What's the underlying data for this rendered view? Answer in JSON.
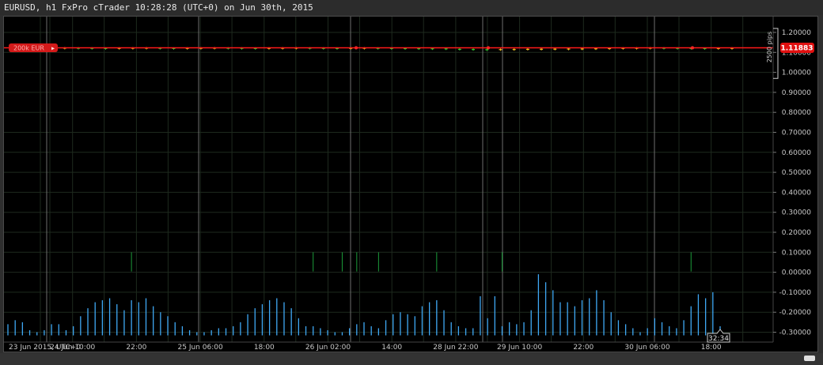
{
  "window": {
    "title": "EURUSD, h1 FxPro cTrader 10:28:28 (UTC+0) on Jun 30th, 2015"
  },
  "colors": {
    "background": "#000000",
    "grid": "#1e2a1e",
    "session_line": "#6e6e6e",
    "price_line": "#ff1a1a",
    "candle_up": "#f0c020",
    "candle_down": "#2ecc2e",
    "volume": "#3fa9f5",
    "indicator_spike": "#1c9c3a",
    "axis_text": "#c8c8c8"
  },
  "price_axis": {
    "ticks": [
      "1.20000",
      "1.10000",
      "1.00000",
      "0.90000",
      "0.80000",
      "0.70000",
      "0.60000",
      "0.50000",
      "0.40000",
      "0.30000",
      "0.20000",
      "0.10000",
      "0.00000",
      "-0.10000",
      "-0.20000",
      "-0.30000"
    ],
    "current_price": "1.11883",
    "range_label": "2500 pips"
  },
  "time_axis": {
    "labels": [
      "23 Jun 2015, UTC+0",
      "24 Jun 10:00",
      "22:00",
      "25 Jun 06:00",
      "18:00",
      "26 Jun 02:00",
      "14:00",
      "28 Jun 22:00",
      "29 Jun 10:00",
      "22:00",
      "30 Jun 06:00",
      "18:00"
    ],
    "countdown": "32:34"
  },
  "position_tag": {
    "label": "200k EUR"
  },
  "icons": {
    "close_position": "close-icon"
  },
  "chart_data": {
    "type": "line",
    "symbol": "EURUSD",
    "timeframe": "h1",
    "ylim": [
      -0.32,
      1.24
    ],
    "price_level": 1.11883,
    "price_series": [
      1.12,
      1.121,
      1.119,
      1.12,
      1.122,
      1.121,
      1.12,
      1.119,
      1.12,
      1.121,
      1.122,
      1.12,
      1.119,
      1.12,
      1.121,
      1.122,
      1.121,
      1.12,
      1.119,
      1.12,
      1.121,
      1.122,
      1.121,
      1.12,
      1.119,
      1.12,
      1.121,
      1.12,
      1.119,
      1.118,
      1.117,
      1.116,
      1.115,
      1.11,
      1.108,
      1.106,
      1.107,
      1.108,
      1.11,
      1.111,
      1.112,
      1.113,
      1.114,
      1.116,
      1.118,
      1.12,
      1.121,
      1.122,
      1.121,
      1.12,
      1.119,
      1.118,
      1.119,
      1.12
    ],
    "volume_series": [
      -0.26,
      -0.24,
      -0.25,
      -0.29,
      -0.3,
      -0.29,
      -0.26,
      -0.26,
      -0.29,
      -0.27,
      -0.22,
      -0.18,
      -0.15,
      -0.14,
      -0.13,
      -0.16,
      -0.19,
      -0.14,
      -0.15,
      -0.13,
      -0.17,
      -0.2,
      -0.22,
      -0.25,
      -0.27,
      -0.29,
      -0.3,
      -0.3,
      -0.29,
      -0.28,
      -0.28,
      -0.27,
      -0.25,
      -0.21,
      -0.18,
      -0.16,
      -0.14,
      -0.13,
      -0.15,
      -0.18,
      -0.23,
      -0.27,
      -0.27,
      -0.28,
      -0.29,
      -0.3,
      -0.3,
      -0.28,
      -0.26,
      -0.25,
      -0.27,
      -0.28,
      -0.24,
      -0.21,
      -0.2,
      -0.21,
      -0.22,
      -0.17,
      -0.15,
      -0.14,
      -0.19,
      -0.25,
      -0.27,
      -0.28,
      -0.28,
      -0.12,
      -0.23,
      -0.12,
      -0.27,
      -0.25,
      -0.26,
      -0.25,
      -0.19,
      -0.01,
      -0.05,
      -0.09,
      -0.15,
      -0.15,
      -0.17,
      -0.14,
      -0.13,
      -0.09,
      -0.14,
      -0.2,
      -0.24,
      -0.26,
      -0.28,
      -0.3,
      -0.28,
      -0.23,
      -0.25,
      -0.27,
      -0.28,
      -0.24,
      -0.17,
      -0.11,
      -0.13,
      -0.1,
      -0.27
    ],
    "indicator_spikes": [
      {
        "x_index": 17,
        "value": 0.1
      },
      {
        "x_index": 42,
        "value": 0.1
      },
      {
        "x_index": 46,
        "value": 0.1
      },
      {
        "x_index": 48,
        "value": 0.1
      },
      {
        "x_index": 51,
        "value": 0.1
      },
      {
        "x_index": 59,
        "value": 0.1
      },
      {
        "x_index": 68,
        "value": 0.1
      },
      {
        "x_index": 94,
        "value": 0.1
      }
    ]
  }
}
